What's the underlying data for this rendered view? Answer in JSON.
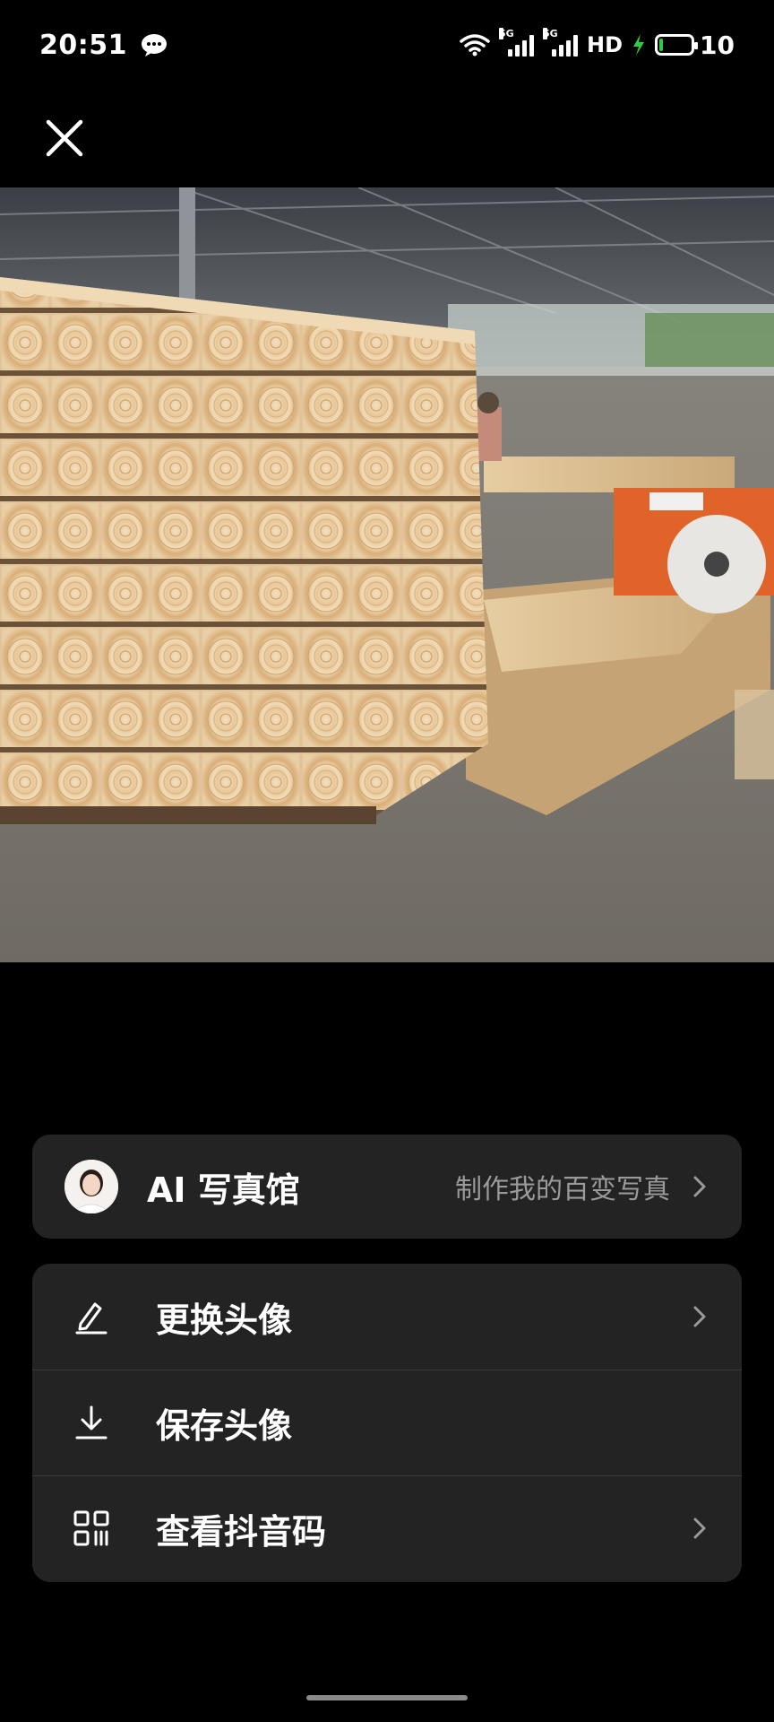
{
  "status_bar": {
    "time": "20:51",
    "network_1": "5G",
    "network_2": "5G",
    "hd": "HD",
    "battery_level": "10",
    "charging_color": "#2ecc40"
  },
  "close_icon": "close-icon",
  "photo": {
    "description_icon": "lumber-stack-photo"
  },
  "ai_card": {
    "title": "AI 写真馆",
    "subtitle": "制作我的百变写真",
    "icon": "avatar-portrait"
  },
  "menu": {
    "items": [
      {
        "label": "更换头像",
        "icon": "edit-pencil-icon",
        "has_chevron": true
      },
      {
        "label": "保存头像",
        "icon": "download-icon",
        "has_chevron": false
      },
      {
        "label": "查看抖音码",
        "icon": "qr-code-icon",
        "has_chevron": true
      }
    ]
  },
  "colors": {
    "background": "#000000",
    "card": "#232323",
    "subtitle": "#9a9a9a",
    "divider": "#3a3a3a"
  }
}
